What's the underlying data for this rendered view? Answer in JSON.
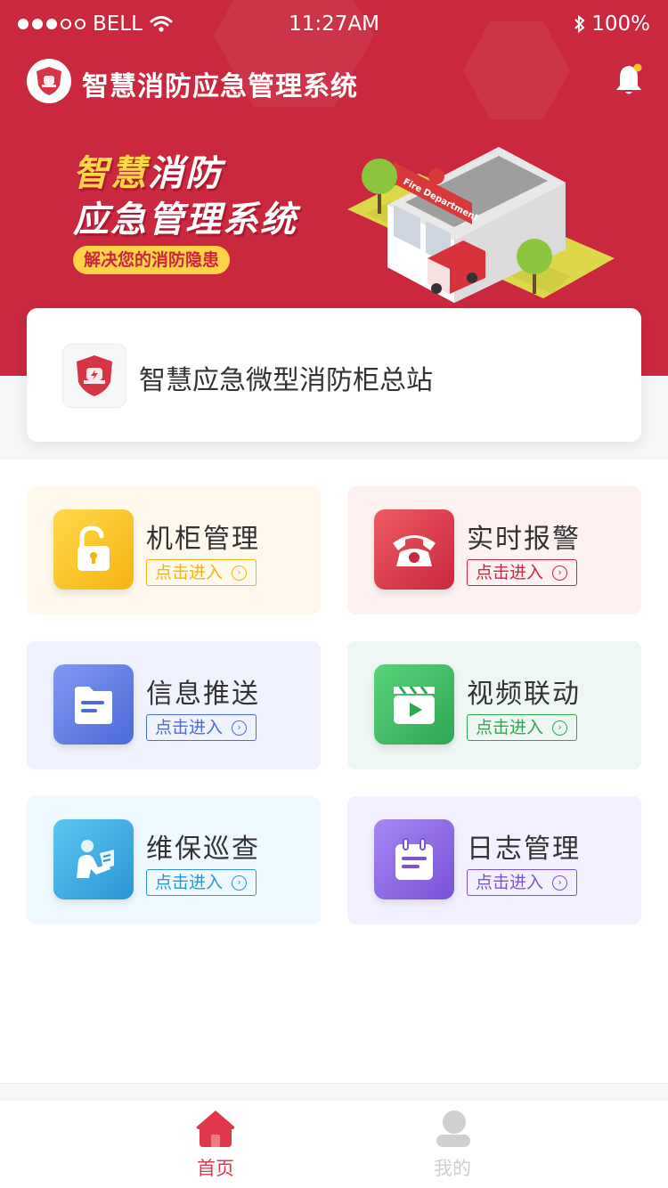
{
  "status_bar": {
    "carrier": "BELL",
    "time": "11:27AM",
    "battery": "100%"
  },
  "header": {
    "app_title": "智慧消防应急管理系统"
  },
  "banner": {
    "line1_a": "智慧",
    "line1_b": "消防",
    "line2": "应急管理系统",
    "pill": "解决您的消防隐患"
  },
  "station": {
    "name": "智慧应急微型消防柜总站"
  },
  "tiles": [
    {
      "title": "机柜管理",
      "button": "点击进入",
      "icon": "unlock-icon",
      "accent": "#f3b511",
      "bg": "#fff8ec"
    },
    {
      "title": "实时报警",
      "button": "点击进入",
      "icon": "telephone-icon",
      "accent": "#c9283e",
      "bg": "#fdf2f1"
    },
    {
      "title": "信息推送",
      "button": "点击进入",
      "icon": "document-icon",
      "accent": "#4b6bd8",
      "bg": "#f0f3fd"
    },
    {
      "title": "视频联动",
      "button": "点击进入",
      "icon": "video-play-icon",
      "accent": "#2fa652",
      "bg": "#eff7f4"
    },
    {
      "title": "维保巡查",
      "button": "点击进入",
      "icon": "inspector-icon",
      "accent": "#2a95d6",
      "bg": "#eefaff"
    },
    {
      "title": "日志管理",
      "button": "点击进入",
      "icon": "calendar-log-icon",
      "accent": "#7b52d8",
      "bg": "#f3f1ff"
    }
  ],
  "tabbar": {
    "home": "首页",
    "mine": "我的",
    "active_color": "#e0384a",
    "inactive_color": "#cfcfcf"
  }
}
